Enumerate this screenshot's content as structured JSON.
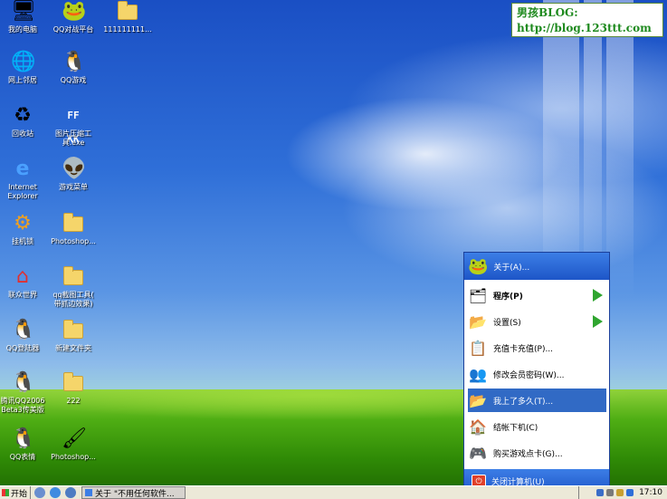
{
  "watermark": {
    "line1": "男孩BLOG:",
    "line2": "http://blog.123ttt.com"
  },
  "desktop_icons": [
    {
      "label": "我的电脑",
      "icon": "computer-icon"
    },
    {
      "label": "QQ对战平台",
      "icon": "qq-battle-icon"
    },
    {
      "label": "111111111...",
      "icon": "folder-icon"
    },
    {
      "label": "网上邻居",
      "icon": "network-icon"
    },
    {
      "label": "QQ游戏",
      "icon": "qq-game-icon"
    },
    {
      "label": "回收站",
      "icon": "recycle-bin-icon"
    },
    {
      "label": "图片压缩工\n具.exe",
      "icon": "image-compress-icon"
    },
    {
      "label": "Internet\nExplorer",
      "icon": "ie-icon"
    },
    {
      "label": "游戏菜单",
      "icon": "game-menu-icon"
    },
    {
      "label": "挂机锁",
      "icon": "gear-lock-icon"
    },
    {
      "label": "Photoshop...",
      "icon": "folder-icon"
    },
    {
      "label": "联众世界",
      "icon": "ourgame-icon"
    },
    {
      "label": "qq截图工具(\n带抓边效果)",
      "icon": "folder-icon"
    },
    {
      "label": "QQ登陆器",
      "icon": "qq-icon"
    },
    {
      "label": "新建文件夹",
      "icon": "folder-icon"
    },
    {
      "label": "腾讯QQ2006\nBeta3传美版",
      "icon": "qq-icon"
    },
    {
      "label": "222",
      "icon": "folder-icon"
    },
    {
      "label": "QQ表情",
      "icon": "qq-emoticon-icon"
    },
    {
      "label": "Photoshop...",
      "icon": "photoshop-icon"
    }
  ],
  "menu": {
    "header": "关于(A)...",
    "items": [
      {
        "label": "程序(P)",
        "icon": "programs-icon",
        "submenu": true,
        "selected": false,
        "bold": true
      },
      {
        "label": "设置(S)",
        "icon": "settings-folder-icon",
        "submenu": true,
        "selected": false,
        "bold": false
      },
      {
        "label": "充值卡充值(P)...",
        "icon": "card-icon",
        "submenu": false,
        "selected": false,
        "bold": false
      },
      {
        "label": "修改会员密码(W)...",
        "icon": "users-icon",
        "submenu": false,
        "selected": false,
        "bold": false
      },
      {
        "label": "我上了多久(T)...",
        "icon": "folder-open-icon",
        "submenu": false,
        "selected": true,
        "bold": false
      },
      {
        "label": "结帐下机(C)",
        "icon": "home-icon",
        "submenu": false,
        "selected": false,
        "bold": false
      },
      {
        "label": "购买游戏点卡(G)...",
        "icon": "gamepad-icon",
        "submenu": false,
        "selected": false,
        "bold": false
      }
    ],
    "shutdown": "关闭计算机(U)"
  },
  "taskbar": {
    "start_label": "开始",
    "window_label": "关于 \"不用任何软件...",
    "clock": "17:10"
  },
  "colors": {
    "menu_blue": "#1e56c8",
    "selected": "#316ac5",
    "watermark_text": "#1e8a1e"
  }
}
